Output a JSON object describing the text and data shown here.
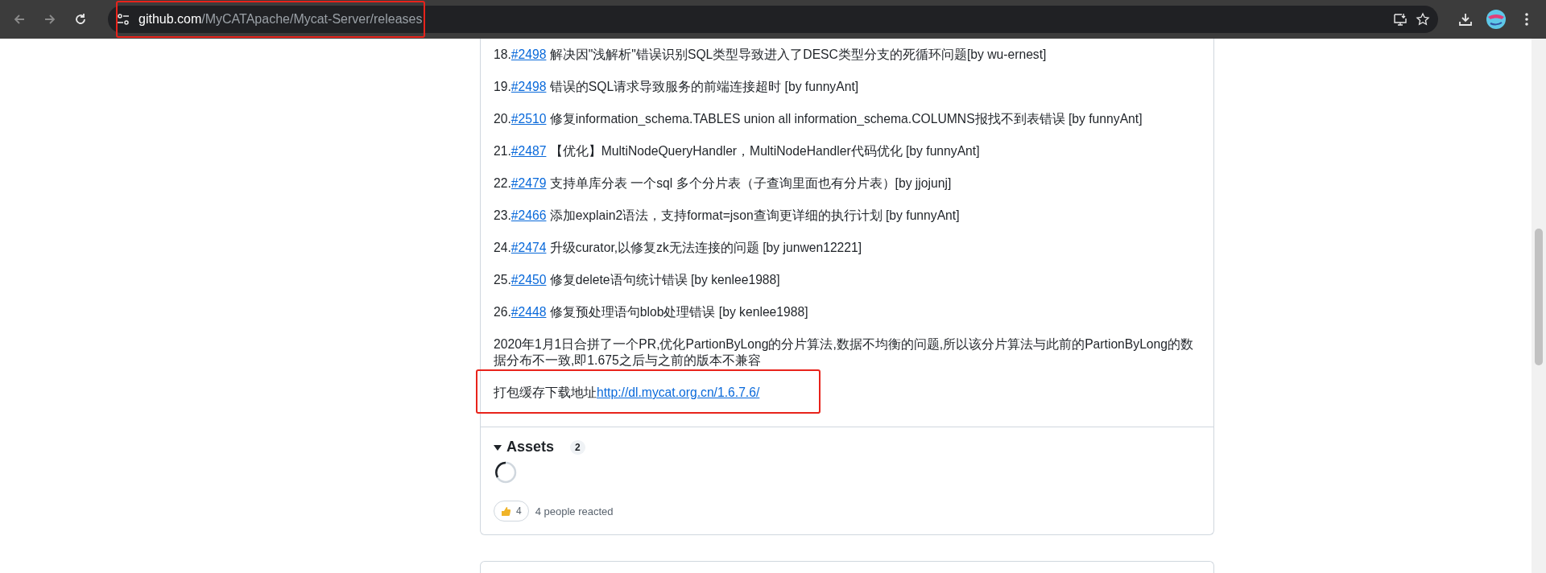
{
  "browser": {
    "url_host": "github.com",
    "url_path": "/MyCATApache/Mycat-Server/releases"
  },
  "changes": [
    {
      "number": "18.",
      "link": "#2498",
      "text": "解决因\"浅解析\"错误识别SQL类型导致进入了DESC类型分支的死循环问题[by wu-ernest]"
    },
    {
      "number": "19.",
      "link": "#2498",
      "text": "错误的SQL请求导致服务的前端连接超时 [by funnyAnt]"
    },
    {
      "number": "20.",
      "link": "#2510",
      "text": "修复information_schema.TABLES union all information_schema.COLUMNS报找不到表错误 [by funnyAnt]"
    },
    {
      "number": "21.",
      "link": "#2487",
      "text": "【优化】MultiNodeQueryHandler，MultiNodeHandler代码优化 [by funnyAnt]"
    },
    {
      "number": "22.",
      "link": "#2479",
      "text": "支持单库分表 一个sql 多个分片表（子查询里面也有分片表）[by jjojunj]"
    },
    {
      "number": "23.",
      "link": "#2466",
      "text": "添加explain2语法，支持format=json查询更详细的执行计划 [by funnyAnt]"
    },
    {
      "number": "24.",
      "link": "#2474",
      "text": "升级curator,以修复zk无法连接的问题 [by junwen12221]"
    },
    {
      "number": "25.",
      "link": "#2450",
      "text": "修复delete语句统计错误 [by kenlee1988]"
    },
    {
      "number": "26.",
      "link": "#2448",
      "text": "修复预处理语句blob处理错误 [by kenlee1988]"
    }
  ],
  "note": "2020年1月1日合拼了一个PR,优化PartionByLong的分片算法,数据不均衡的问题,所以该分片算法与此前的PartionByLong的数据分布不一致,即1.675之后与之前的版本不兼容",
  "download": {
    "text": "打包缓存下载地址",
    "link": "http://dl.mycat.org.cn/1.6.7.6/"
  },
  "assets": {
    "title": "Assets",
    "count": "2",
    "expanded": true
  },
  "reactions": {
    "count": "4",
    "summary": "4 people reacted"
  }
}
